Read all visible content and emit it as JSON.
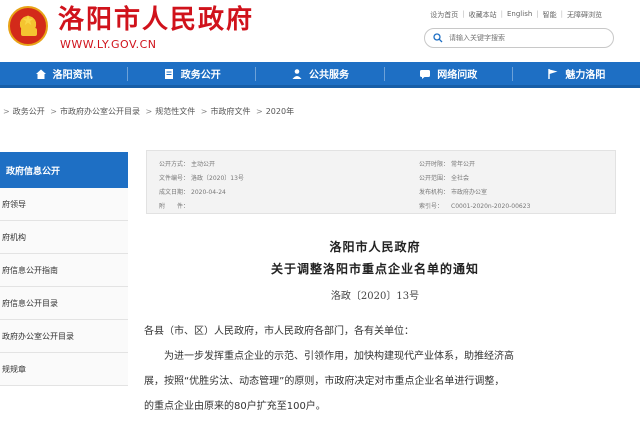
{
  "header": {
    "site_title": "洛阳市人民政府",
    "site_url": "WWW.LY.GOV.CN",
    "top_links": [
      "设为首页",
      "收藏本站",
      "English",
      "智能",
      "无障碍浏览"
    ],
    "search_placeholder": "请输入关键字搜索"
  },
  "nav": {
    "items": [
      {
        "label": "洛阳资讯",
        "icon": "home-icon"
      },
      {
        "label": "政务公开",
        "icon": "document-icon"
      },
      {
        "label": "公共服务",
        "icon": "people-icon"
      },
      {
        "label": "网络问政",
        "icon": "chat-icon"
      },
      {
        "label": "魅力洛阳",
        "icon": "flag-icon"
      }
    ]
  },
  "breadcrumb": [
    "政务公开",
    "市政府办公室公开目录",
    "规范性文件",
    "市政府文件",
    "2020年"
  ],
  "sidebar": {
    "heading": "政府信息公开",
    "items": [
      "府领导",
      "府机构",
      "府信息公开指南",
      "府信息公开目录",
      "政府办公室公开目录",
      "规规章"
    ]
  },
  "meta": {
    "left": [
      {
        "k": "公开方式：",
        "v": "主动公开"
      },
      {
        "k": "文件编号：",
        "v": "洛政〔2020〕13号"
      },
      {
        "k": "成文日期：",
        "v": "2020-04-24"
      },
      {
        "k": "附　　件：",
        "v": ""
      }
    ],
    "right": [
      {
        "k": "公开时限：",
        "v": "常年公开"
      },
      {
        "k": "公开范围：",
        "v": "全社会"
      },
      {
        "k": "发布机构：",
        "v": "市政府办公室"
      },
      {
        "k": "索引号：",
        "v": "C0001-2020n-2020-00623"
      }
    ]
  },
  "document": {
    "title1": "洛阳市人民政府",
    "title2": "关于调整洛阳市重点企业名单的通知",
    "number": "洛政〔2020〕13号",
    "paragraphs": [
      "各县（市、区）人民政府，市人民政府各部门，各有关单位：",
      "　　为进一步发挥重点企业的示范、引领作用，加快构建现代产业体系，助推经济高",
      "展，按照“优胜劣汰、动态管理”的原则，市政府决定对市重点企业名单进行调整，",
      "的重点企业由原来的80户扩充至100户。"
    ]
  },
  "colors": {
    "brand_red": "#d0121b",
    "nav_blue": "#1e6fc4"
  }
}
